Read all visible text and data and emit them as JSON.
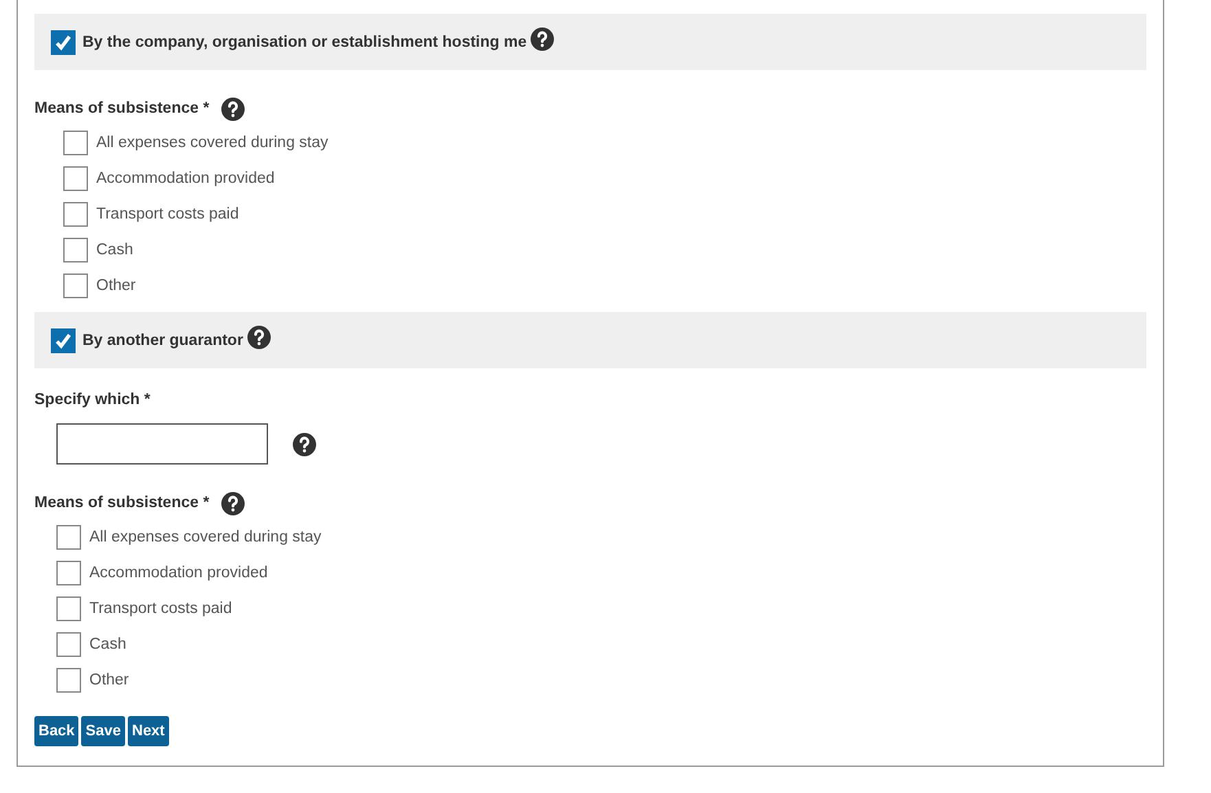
{
  "sections": [
    {
      "title": "By the company, organisation or establishment hosting me",
      "checked": true,
      "fields": [
        {
          "kind": "checkboxes",
          "label": "Means of subsistence *",
          "options": [
            {
              "label": "All expenses covered during stay",
              "checked": false
            },
            {
              "label": "Accommodation provided",
              "checked": false
            },
            {
              "label": "Transport costs paid",
              "checked": false
            },
            {
              "label": "Cash",
              "checked": false
            },
            {
              "label": "Other",
              "checked": false
            }
          ]
        }
      ]
    },
    {
      "title": "By another guarantor",
      "checked": true,
      "fields": [
        {
          "kind": "text",
          "label": "Specify which *"
        },
        {
          "kind": "checkboxes",
          "label": "Means of subsistence *",
          "options": [
            {
              "label": "All expenses covered during stay",
              "checked": false
            },
            {
              "label": "Accommodation provided",
              "checked": false
            },
            {
              "label": "Transport costs paid",
              "checked": false
            },
            {
              "label": "Cash",
              "checked": false
            },
            {
              "label": "Other",
              "checked": false
            }
          ]
        }
      ]
    }
  ],
  "buttons": [
    "Back",
    "Save",
    "Next"
  ]
}
